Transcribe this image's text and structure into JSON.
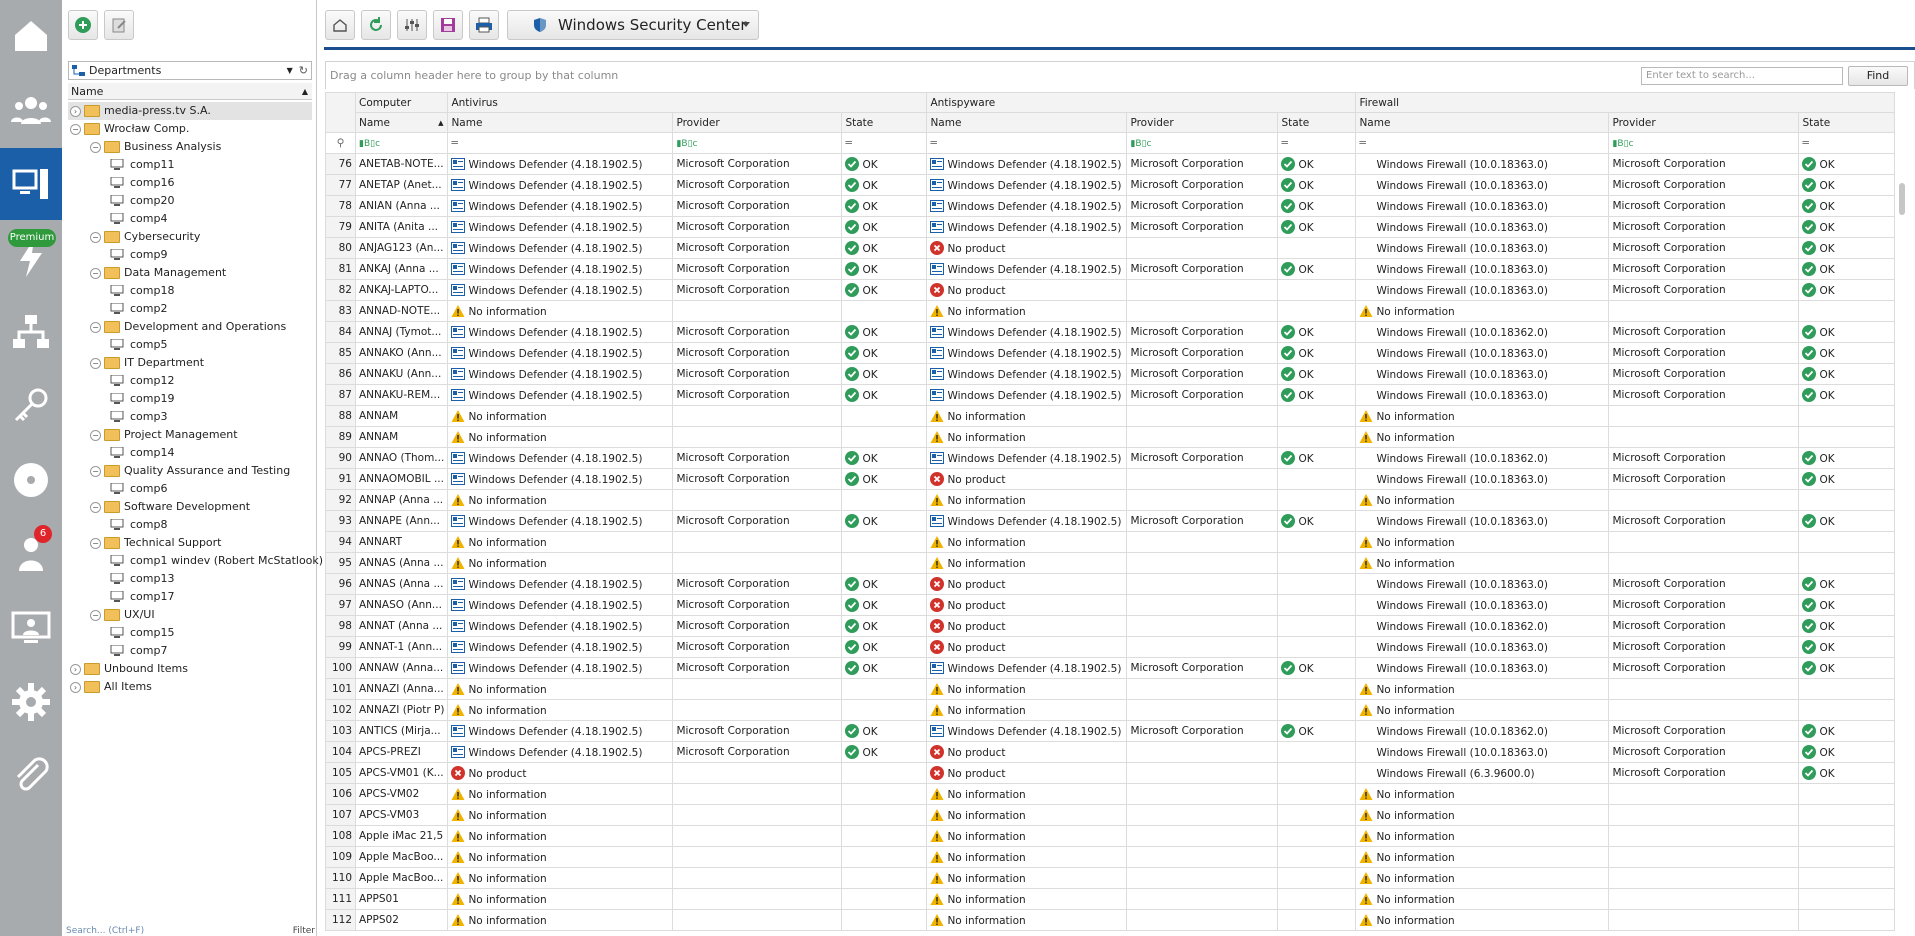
{
  "rail": {
    "items": [
      "home-icon",
      "users-icon",
      "computer-icon",
      "lightning-icon",
      "network-icon",
      "key-icon",
      "disc-icon",
      "helpdesk-icon",
      "remote-desktop-icon",
      "settings-icon",
      "attachment-icon"
    ],
    "premium_label": "Premium",
    "badge_count": "6"
  },
  "departments": {
    "combo_label": "Departments",
    "column_header": "Name",
    "tree": [
      {
        "label": "media-press.tv S.A.",
        "level": 0,
        "type": "folder",
        "selected": true
      },
      {
        "label": "Wrocław Comp.",
        "level": 0,
        "type": "folder",
        "expanded": true
      },
      {
        "label": "Business Analysis",
        "level": 1,
        "type": "folder",
        "expanded": true
      },
      {
        "label": "comp11",
        "level": 2,
        "type": "pc"
      },
      {
        "label": "comp16",
        "level": 2,
        "type": "pc"
      },
      {
        "label": "comp20",
        "level": 2,
        "type": "pc"
      },
      {
        "label": "comp4",
        "level": 2,
        "type": "pc"
      },
      {
        "label": "Cybersecurity",
        "level": 1,
        "type": "folder",
        "expanded": true
      },
      {
        "label": "comp9",
        "level": 2,
        "type": "pc"
      },
      {
        "label": "Data Management",
        "level": 1,
        "type": "folder",
        "expanded": true
      },
      {
        "label": "comp18",
        "level": 2,
        "type": "pc"
      },
      {
        "label": "comp2",
        "level": 2,
        "type": "pc"
      },
      {
        "label": "Development and Operations",
        "level": 1,
        "type": "folder",
        "expanded": true
      },
      {
        "label": "comp5",
        "level": 2,
        "type": "pc"
      },
      {
        "label": "IT Department",
        "level": 1,
        "type": "folder",
        "expanded": true
      },
      {
        "label": "comp12",
        "level": 2,
        "type": "pc"
      },
      {
        "label": "comp19",
        "level": 2,
        "type": "pc"
      },
      {
        "label": "comp3",
        "level": 2,
        "type": "pc"
      },
      {
        "label": "Project Management",
        "level": 1,
        "type": "folder",
        "expanded": true
      },
      {
        "label": "comp14",
        "level": 2,
        "type": "pc"
      },
      {
        "label": "Quality Assurance and Testing",
        "level": 1,
        "type": "folder",
        "expanded": true
      },
      {
        "label": "comp6",
        "level": 2,
        "type": "pc"
      },
      {
        "label": "Software Development",
        "level": 1,
        "type": "folder",
        "expanded": true
      },
      {
        "label": "comp8",
        "level": 2,
        "type": "pc"
      },
      {
        "label": "Technical Support",
        "level": 1,
        "type": "folder",
        "expanded": true
      },
      {
        "label": "comp1 windev (Robert McStatlook)",
        "level": 2,
        "type": "pc"
      },
      {
        "label": "comp13",
        "level": 2,
        "type": "pc"
      },
      {
        "label": "comp17",
        "level": 2,
        "type": "pc"
      },
      {
        "label": "UX/UI",
        "level": 1,
        "type": "folder",
        "expanded": true
      },
      {
        "label": "comp15",
        "level": 2,
        "type": "pc"
      },
      {
        "label": "comp7",
        "level": 2,
        "type": "pc"
      },
      {
        "label": "Unbound Items",
        "level": 0,
        "type": "folder"
      },
      {
        "label": "All Items",
        "level": 0,
        "type": "folder"
      }
    ],
    "search_placeholder": "Search... (Ctrl+F)",
    "filter_label": "Filter"
  },
  "toolbar": {
    "view_label": "Windows Security Center"
  },
  "grid": {
    "group_hint": "Drag a column header here to group by that column",
    "search_placeholder": "Enter text to search...",
    "find_label": "Find",
    "bands": [
      "Computer",
      "Antivirus",
      "Antispyware",
      "Firewall"
    ],
    "columns": [
      "Name",
      "Name",
      "Provider",
      "State",
      "Name",
      "Provider",
      "State",
      "Name",
      "Provider",
      "State"
    ],
    "rows": [
      [
        "76",
        "ANETAB-NOTE...",
        "av:Windows Defender (4.18.1902.5)",
        "Microsoft Corporation",
        "ok:OK",
        "av:Windows Defender (4.18.1902.5)",
        "Microsoft Corporation",
        "ok:OK",
        "fw:Windows Firewall (10.0.18363.0)",
        "Microsoft Corporation",
        "ok:OK"
      ],
      [
        "77",
        "ANETAP (Anet...",
        "av:Windows Defender (4.18.1902.5)",
        "Microsoft Corporation",
        "ok:OK",
        "av:Windows Defender (4.18.1902.5)",
        "Microsoft Corporation",
        "ok:OK",
        "fw:Windows Firewall (10.0.18363.0)",
        "Microsoft Corporation",
        "ok:OK"
      ],
      [
        "78",
        "ANIAN (Anna ...",
        "av:Windows Defender (4.18.1902.5)",
        "Microsoft Corporation",
        "ok:OK",
        "av:Windows Defender (4.18.1902.5)",
        "Microsoft Corporation",
        "ok:OK",
        "fw:Windows Firewall (10.0.18363.0)",
        "Microsoft Corporation",
        "ok:OK"
      ],
      [
        "79",
        "ANITA (Anita ...",
        "av:Windows Defender (4.18.1902.5)",
        "Microsoft Corporation",
        "ok:OK",
        "av:Windows Defender (4.18.1902.5)",
        "Microsoft Corporation",
        "ok:OK",
        "fw:Windows Firewall (10.0.18363.0)",
        "Microsoft Corporation",
        "ok:OK"
      ],
      [
        "80",
        "ANJAG123 (An...",
        "av:Windows Defender (4.18.1902.5)",
        "Microsoft Corporation",
        "ok:OK",
        "err:No product",
        "",
        "",
        "fw:Windows Firewall (10.0.18363.0)",
        "Microsoft Corporation",
        "ok:OK"
      ],
      [
        "81",
        "ANKAJ (Anna ...",
        "av:Windows Defender (4.18.1902.5)",
        "Microsoft Corporation",
        "ok:OK",
        "av:Windows Defender (4.18.1902.5)",
        "Microsoft Corporation",
        "ok:OK",
        "fw:Windows Firewall (10.0.18363.0)",
        "Microsoft Corporation",
        "ok:OK"
      ],
      [
        "82",
        "ANKAJ-LAPTO...",
        "av:Windows Defender (4.18.1902.5)",
        "Microsoft Corporation",
        "ok:OK",
        "err:No product",
        "",
        "",
        "fw:Windows Firewall (10.0.18363.0)",
        "Microsoft Corporation",
        "ok:OK"
      ],
      [
        "83",
        "ANNAD-NOTE...",
        "warn:No information",
        "",
        "",
        "warn:No information",
        "",
        "",
        "warn:No information",
        "",
        ""
      ],
      [
        "84",
        "ANNAJ (Tymot...",
        "av:Windows Defender (4.18.1902.5)",
        "Microsoft Corporation",
        "ok:OK",
        "av:Windows Defender (4.18.1902.5)",
        "Microsoft Corporation",
        "ok:OK",
        "fw:Windows Firewall (10.0.18362.0)",
        "Microsoft Corporation",
        "ok:OK"
      ],
      [
        "85",
        "ANNAKO (Ann...",
        "av:Windows Defender (4.18.1902.5)",
        "Microsoft Corporation",
        "ok:OK",
        "av:Windows Defender (4.18.1902.5)",
        "Microsoft Corporation",
        "ok:OK",
        "fw:Windows Firewall (10.0.18363.0)",
        "Microsoft Corporation",
        "ok:OK"
      ],
      [
        "86",
        "ANNAKU (Ann...",
        "av:Windows Defender (4.18.1902.5)",
        "Microsoft Corporation",
        "ok:OK",
        "av:Windows Defender (4.18.1902.5)",
        "Microsoft Corporation",
        "ok:OK",
        "fw:Windows Firewall (10.0.18363.0)",
        "Microsoft Corporation",
        "ok:OK"
      ],
      [
        "87",
        "ANNAKU-REM...",
        "av:Windows Defender (4.18.1902.5)",
        "Microsoft Corporation",
        "ok:OK",
        "av:Windows Defender (4.18.1902.5)",
        "Microsoft Corporation",
        "ok:OK",
        "fw:Windows Firewall (10.0.18363.0)",
        "Microsoft Corporation",
        "ok:OK"
      ],
      [
        "88",
        "ANNAM",
        "warn:No information",
        "",
        "",
        "warn:No information",
        "",
        "",
        "warn:No information",
        "",
        ""
      ],
      [
        "89",
        "ANNAM",
        "warn:No information",
        "",
        "",
        "warn:No information",
        "",
        "",
        "warn:No information",
        "",
        ""
      ],
      [
        "90",
        "ANNAO (Thom...",
        "av:Windows Defender (4.18.1902.5)",
        "Microsoft Corporation",
        "ok:OK",
        "av:Windows Defender (4.18.1902.5)",
        "Microsoft Corporation",
        "ok:OK",
        "fw:Windows Firewall (10.0.18362.0)",
        "Microsoft Corporation",
        "ok:OK"
      ],
      [
        "91",
        "ANNAOMOBIL ...",
        "av:Windows Defender (4.18.1902.5)",
        "Microsoft Corporation",
        "ok:OK",
        "err:No product",
        "",
        "",
        "fw:Windows Firewall (10.0.18363.0)",
        "Microsoft Corporation",
        "ok:OK"
      ],
      [
        "92",
        "ANNAP (Anna ...",
        "warn:No information",
        "",
        "",
        "warn:No information",
        "",
        "",
        "warn:No information",
        "",
        ""
      ],
      [
        "93",
        "ANNAPE (Ann...",
        "av:Windows Defender (4.18.1902.5)",
        "Microsoft Corporation",
        "ok:OK",
        "av:Windows Defender (4.18.1902.5)",
        "Microsoft Corporation",
        "ok:OK",
        "fw:Windows Firewall (10.0.18363.0)",
        "Microsoft Corporation",
        "ok:OK"
      ],
      [
        "94",
        "ANNART",
        "warn:No information",
        "",
        "",
        "warn:No information",
        "",
        "",
        "warn:No information",
        "",
        ""
      ],
      [
        "95",
        "ANNAS (Anna ...",
        "warn:No information",
        "",
        "",
        "warn:No information",
        "",
        "",
        "warn:No information",
        "",
        ""
      ],
      [
        "96",
        "ANNAS (Anna ...",
        "av:Windows Defender (4.18.1902.5)",
        "Microsoft Corporation",
        "ok:OK",
        "err:No product",
        "",
        "",
        "fw:Windows Firewall (10.0.18363.0)",
        "Microsoft Corporation",
        "ok:OK"
      ],
      [
        "97",
        "ANNASO (Ann...",
        "av:Windows Defender (4.18.1902.5)",
        "Microsoft Corporation",
        "ok:OK",
        "err:No product",
        "",
        "",
        "fw:Windows Firewall (10.0.18363.0)",
        "Microsoft Corporation",
        "ok:OK"
      ],
      [
        "98",
        "ANNAT (Anna ...",
        "av:Windows Defender (4.18.1902.5)",
        "Microsoft Corporation",
        "ok:OK",
        "err:No product",
        "",
        "",
        "fw:Windows Firewall (10.0.18362.0)",
        "Microsoft Corporation",
        "ok:OK"
      ],
      [
        "99",
        "ANNAT-1 (Ann...",
        "av:Windows Defender (4.18.1902.5)",
        "Microsoft Corporation",
        "ok:OK",
        "err:No product",
        "",
        "",
        "fw:Windows Firewall (10.0.18363.0)",
        "Microsoft Corporation",
        "ok:OK"
      ],
      [
        "100",
        "ANNAW (Anna...",
        "av:Windows Defender (4.18.1902.5)",
        "Microsoft Corporation",
        "ok:OK",
        "av:Windows Defender (4.18.1902.5)",
        "Microsoft Corporation",
        "ok:OK",
        "fw:Windows Firewall (10.0.18363.0)",
        "Microsoft Corporation",
        "ok:OK"
      ],
      [
        "101",
        "ANNAZI (Anna...",
        "warn:No information",
        "",
        "",
        "warn:No information",
        "",
        "",
        "warn:No information",
        "",
        ""
      ],
      [
        "102",
        "ANNAZI (Piotr P)",
        "warn:No information",
        "",
        "",
        "warn:No information",
        "",
        "",
        "warn:No information",
        "",
        ""
      ],
      [
        "103",
        "ANTICS (Mirja...",
        "av:Windows Defender (4.18.1902.5)",
        "Microsoft Corporation",
        "ok:OK",
        "av:Windows Defender (4.18.1902.5)",
        "Microsoft Corporation",
        "ok:OK",
        "fw:Windows Firewall (10.0.18362.0)",
        "Microsoft Corporation",
        "ok:OK"
      ],
      [
        "104",
        "APCS-PREZI",
        "av:Windows Defender (4.18.1902.5)",
        "Microsoft Corporation",
        "ok:OK",
        "err:No product",
        "",
        "",
        "fw:Windows Firewall (10.0.18363.0)",
        "Microsoft Corporation",
        "ok:OK"
      ],
      [
        "105",
        "APCS-VM01 (K...",
        "err:No product",
        "",
        "",
        "err:No product",
        "",
        "",
        "fw:Windows Firewall (6.3.9600.0)",
        "Microsoft Corporation",
        "ok:OK"
      ],
      [
        "106",
        "APCS-VM02",
        "warn:No information",
        "",
        "",
        "warn:No information",
        "",
        "",
        "warn:No information",
        "",
        ""
      ],
      [
        "107",
        "APCS-VM03",
        "warn:No information",
        "",
        "",
        "warn:No information",
        "",
        "",
        "warn:No information",
        "",
        ""
      ],
      [
        "108",
        "Apple iMac 21,5",
        "warn:No information",
        "",
        "",
        "warn:No information",
        "",
        "",
        "warn:No information",
        "",
        ""
      ],
      [
        "109",
        "Apple MacBoo...",
        "warn:No information",
        "",
        "",
        "warn:No information",
        "",
        "",
        "warn:No information",
        "",
        ""
      ],
      [
        "110",
        "Apple MacBoo...",
        "warn:No information",
        "",
        "",
        "warn:No information",
        "",
        "",
        "warn:No information",
        "",
        ""
      ],
      [
        "111",
        "APPS01",
        "warn:No information",
        "",
        "",
        "warn:No information",
        "",
        "",
        "warn:No information",
        "",
        ""
      ],
      [
        "112",
        "APPS02",
        "warn:No information",
        "",
        "",
        "warn:No information",
        "",
        "",
        "warn:No information",
        "",
        ""
      ]
    ]
  },
  "colors": {
    "accent": "#1b5fa8",
    "ok": "#2f9c5a",
    "error": "#d0332c",
    "warning": "#f0b400"
  }
}
